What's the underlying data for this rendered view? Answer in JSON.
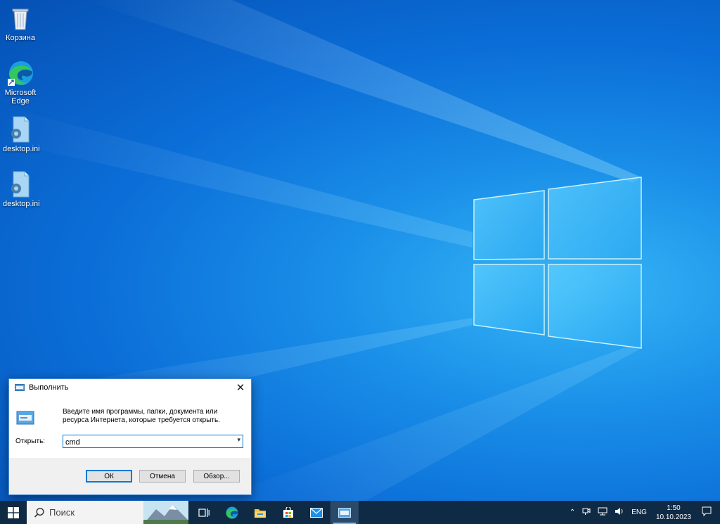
{
  "desktop": {
    "icons": [
      {
        "label": "Корзина"
      },
      {
        "label": "Microsoft Edge"
      },
      {
        "label": "desktop.ini"
      },
      {
        "label": "desktop.ini"
      }
    ]
  },
  "run_dialog": {
    "title": "Выполнить",
    "description": "Введите имя программы, папки, документа или ресурса Интернета, которые требуется открыть.",
    "open_label": "Открыть:",
    "input_value": "cmd",
    "ok_label": "ОК",
    "cancel_label": "Отмена",
    "browse_label": "Обзор..."
  },
  "taskbar": {
    "search_placeholder": "Поиск",
    "lang": "ENG",
    "time": "1:50",
    "date": "10.10.2023"
  },
  "colors": {
    "accent": "#0078d7",
    "taskbar": "#0f2a44"
  }
}
